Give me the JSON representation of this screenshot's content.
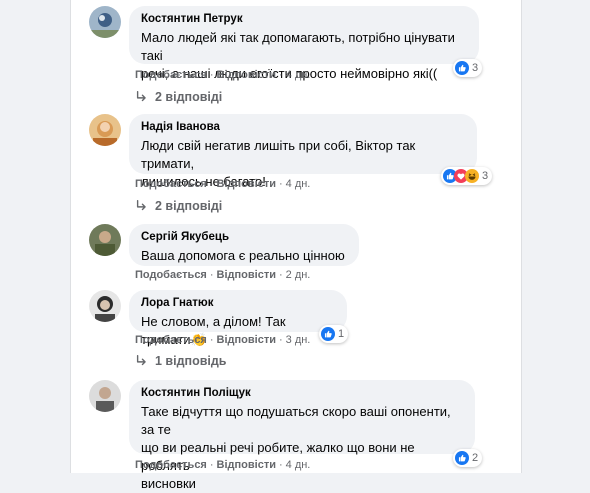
{
  "comments": [
    {
      "author": "Костянтин Петрук",
      "text_lines": [
        "Мало людей які так допомагають, потрібно цінувати такі",
        "речі, а наші люди егоїсти просто неймовірно які(("
      ],
      "like": "Подобається",
      "reply": "Відповісти",
      "time": "4 дн.",
      "reaction_count": "3",
      "replies_label": "2 відповіді"
    },
    {
      "author": "Надія Іванова",
      "text_lines": [
        "Люди свій негатив лишіть при собі, Віктор так тримати,",
        "лишилось не багато!"
      ],
      "like": "Подобається",
      "reply": "Відповісти",
      "time": "4 дн.",
      "reaction_count": "3",
      "replies_label": "2 відповіді"
    },
    {
      "author": "Сергій Якубець",
      "text_lines": [
        "Ваша допомога є реально цінною"
      ],
      "like": "Подобається",
      "reply": "Відповісти",
      "time": "2 дн."
    },
    {
      "author": "Лора Гнатюк",
      "text_lines": [
        "Не словом, а ділом! Так тримати👏"
      ],
      "like": "Подобається",
      "reply": "Відповісти",
      "time": "3 дн.",
      "reaction_count": "1",
      "replies_label": "1 відповідь"
    },
    {
      "author": "Костянтин Поліщук",
      "text_lines": [
        "Таке відчуття що подушаться скоро ваші опоненти, за те",
        "що ви реальні речі робите, жалко що вони не роблять",
        "висновки"
      ],
      "like": "Подобається",
      "reply": "Відповісти",
      "time": "4 дн.",
      "reaction_count": "2"
    }
  ],
  "colors": {
    "like_blue": "#1877f2",
    "love_red": "#f33e58",
    "haha_yellow": "#f7b125",
    "bubble": "#f0f2f5",
    "meta": "#65676b"
  },
  "icons": {
    "reply_arrow": "reply-arrow-icon",
    "like": "like-icon",
    "love": "love-icon",
    "haha": "haha-icon"
  }
}
